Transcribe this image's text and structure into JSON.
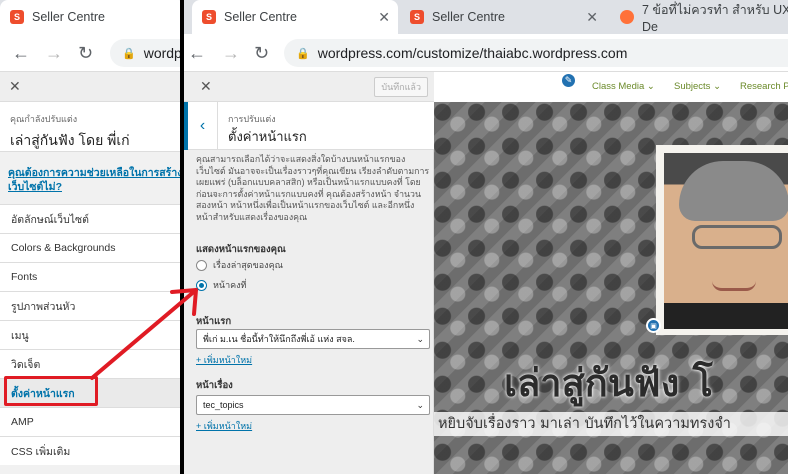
{
  "left": {
    "tabs": [
      {
        "title": "Seller Centre",
        "favicon": "shopee-icon"
      }
    ],
    "address_text": "wordpr",
    "customizer_label": "คุณกำลังปรับแต่ง",
    "site_title": "เล่าสู่กันฟัง โดย พี่เก่",
    "help_link": "คุณต้องการความช่วยเหลือในการสร้างเว็บไซต์ไม่?",
    "menu_items": [
      "อัตลักษณ์เว็บไซต์",
      "Colors & Backgrounds",
      "Fonts",
      "รูปภาพส่วนหัว",
      "เมนู",
      "วิดเจ็ต",
      "ตั้งค่าหน้าแรก",
      "AMP",
      "CSS เพิ่มเติม"
    ]
  },
  "right": {
    "tabs": [
      {
        "title": "Seller Centre",
        "favicon": "shopee-icon"
      },
      {
        "title": "Seller Centre",
        "favicon": "shopee-icon"
      },
      {
        "title": "7 ข้อที่ไม่ควรทำ สำหรับ UX De",
        "favicon": "firefox-icon"
      }
    ],
    "address": "wordpress.com/customize/thaiabc.wordpress.com",
    "save_label": "บันทึกแล้ว",
    "section_sub": "การปรับแต่ง",
    "section_title": "ตั้งค่าหน้าแรก",
    "description": "คุณสามารถเลือกได้ว่าจะแสดงสิ่งใดบ้างบนหน้าแรกของเว็บไซต์ มันอาจจะเป็นเรื่องราวๆที่คุณเขียน เรียงลำดับตามการเผยแพร่ (บล็อกแบบคลาสสิก) หรือเป็นหน้าแรกแบบคงที่ โดยก่อนจะการตั้งค่าหน้าแรกแบบคงที่ คุณต้องสร้างหน้า จำนวนสองหน้า หน้าหนึ่งเพื่อเป็นหน้าแรกของเว็บไซต์ และอีกหนึ่งหน้าสำหรับแสดงเรื่องของคุณ",
    "display_label": "แสดงหน้าแรกของคุณ",
    "radio_options": [
      "เรื่องล่าสุดของคุณ",
      "หน้าคงที่"
    ],
    "radio_selected": "หน้าคงที่",
    "homepage_label": "หน้าแรก",
    "homepage_value": "พี่เก่ ม.เน ชื่อนี้ทำให้นึกถึงพี่เอ้ แห่ง สจล.",
    "add_page": "+ เพิ่มหน้าใหม่",
    "posts_label": "หน้าเรื่อง",
    "posts_value": "tec_topics",
    "preview": {
      "menu": [
        "Class Media",
        "Subjects",
        "Research Pa"
      ],
      "hero_title": "เล่าสู่กันฟัง โ",
      "tagline": "หยิบจับเรื่องราว มาเล่า บันทึกไว้ในความทรงจำ"
    }
  },
  "colors": {
    "accent": "#0073aa",
    "annotation": "#e01b24",
    "shopee": "#ee4d2d"
  }
}
